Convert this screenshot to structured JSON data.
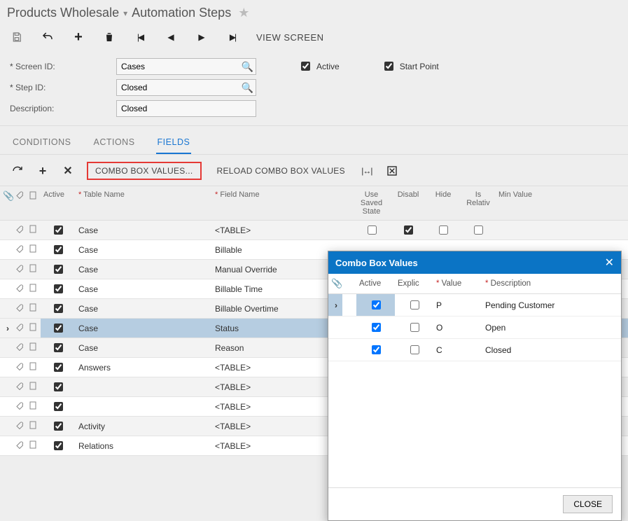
{
  "breadcrumb": {
    "parent": "Products Wholesale",
    "title": "Automation Steps"
  },
  "mainToolbar": {
    "viewScreen": "VIEW SCREEN"
  },
  "form": {
    "screenIdLabel": "Screen ID:",
    "screenIdValue": "Cases",
    "stepIdLabel": "Step ID:",
    "stepIdValue": "Closed",
    "descriptionLabel": "Description:",
    "descriptionValue": "Closed",
    "activeLabel": "Active",
    "startPointLabel": "Start Point"
  },
  "tabs": {
    "conditions": "CONDITIONS",
    "actions": "ACTIONS",
    "fields": "FIELDS"
  },
  "gridToolbar": {
    "comboBoxValues": "COMBO BOX VALUES...",
    "reloadCombo": "RELOAD COMBO BOX VALUES"
  },
  "grid": {
    "headers": {
      "active": "Active",
      "tableName": "Table Name",
      "fieldName": "Field Name",
      "useSaved": "Use Saved State",
      "disable": "Disabl",
      "hide": "Hide",
      "isRelative": "Is Relativ",
      "minValue": "Min Value"
    },
    "rows": [
      {
        "active": true,
        "table": "Case",
        "field": "<TABLE>",
        "useSaved": false,
        "disable": true,
        "hide": false,
        "isRel": false,
        "sel": false,
        "alt": true
      },
      {
        "active": true,
        "table": "Case",
        "field": "Billable",
        "sel": false,
        "alt": false
      },
      {
        "active": true,
        "table": "Case",
        "field": "Manual Override",
        "sel": false,
        "alt": true
      },
      {
        "active": true,
        "table": "Case",
        "field": "Billable Time",
        "sel": false,
        "alt": false
      },
      {
        "active": true,
        "table": "Case",
        "field": "Billable Overtime",
        "sel": false,
        "alt": true
      },
      {
        "active": true,
        "table": "Case",
        "field": "Status",
        "sel": true,
        "alt": false
      },
      {
        "active": true,
        "table": "Case",
        "field": "Reason",
        "sel": false,
        "alt": true
      },
      {
        "active": true,
        "table": "Answers",
        "field": "<TABLE>",
        "sel": false,
        "alt": false
      },
      {
        "active": true,
        "table": "",
        "field": "<TABLE>",
        "sel": false,
        "alt": true
      },
      {
        "active": true,
        "table": "",
        "field": "<TABLE>",
        "sel": false,
        "alt": false
      },
      {
        "active": true,
        "table": "Activity",
        "field": "<TABLE>",
        "sel": false,
        "alt": true
      },
      {
        "active": true,
        "table": "Relations",
        "field": "<TABLE>",
        "sel": false,
        "alt": false
      }
    ]
  },
  "dialog": {
    "title": "Combo Box Values",
    "headers": {
      "active": "Active",
      "explicit": "Explic",
      "value": "Value",
      "description": "Description"
    },
    "rows": [
      {
        "active": true,
        "explicit": false,
        "value": "P",
        "description": "Pending Customer",
        "sel": true
      },
      {
        "active": true,
        "explicit": false,
        "value": "O",
        "description": "Open",
        "sel": false
      },
      {
        "active": true,
        "explicit": false,
        "value": "C",
        "description": "Closed",
        "sel": false
      }
    ],
    "closeBtn": "CLOSE"
  }
}
